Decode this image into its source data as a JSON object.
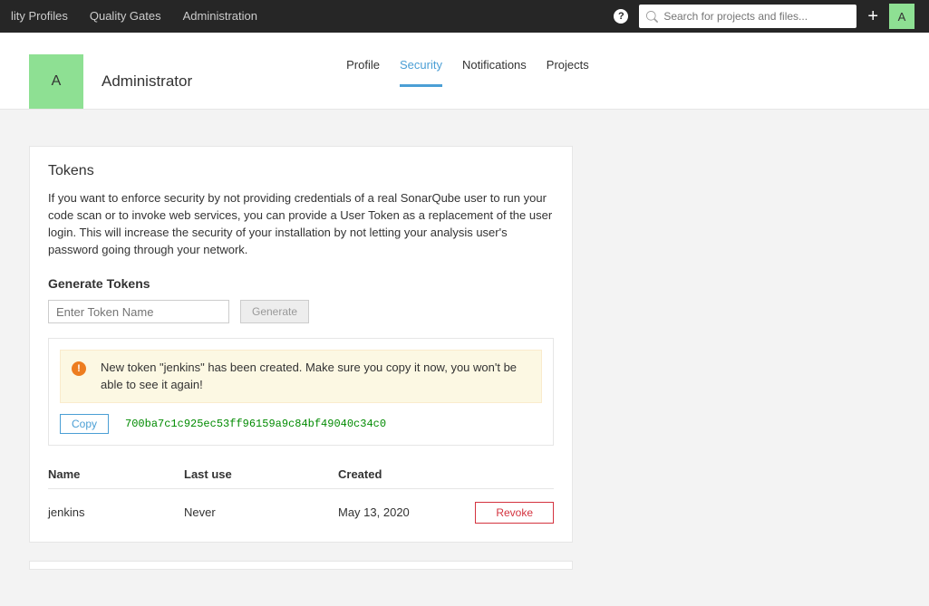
{
  "topnav": {
    "items": [
      "lity Profiles",
      "Quality Gates",
      "Administration"
    ],
    "search_placeholder": "Search for projects and files...",
    "avatar_letter": "A"
  },
  "user": {
    "avatar_letter": "A",
    "name": "Administrator"
  },
  "tabs": [
    "Profile",
    "Security",
    "Notifications",
    "Projects"
  ],
  "active_tab_index": 1,
  "tokens_panel": {
    "title": "Tokens",
    "description": "If you want to enforce security by not providing credentials of a real SonarQube user to run your code scan or to invoke web services, you can provide a User Token as a replacement of the user login. This will increase the security of your installation by not letting your analysis user's password going through your network.",
    "generate_label": "Generate Tokens",
    "token_name_placeholder": "Enter Token Name",
    "generate_button": "Generate",
    "alert_message": "New token \"jenkins\" has been created. Make sure you copy it now, you won't be able to see it again!",
    "copy_button": "Copy",
    "token_value": "700ba7c1c925ec53ff96159a9c84bf49040c34c0",
    "columns": {
      "name": "Name",
      "last_use": "Last use",
      "created": "Created"
    },
    "rows": [
      {
        "name": "jenkins",
        "last_use": "Never",
        "created": "May 13, 2020"
      }
    ],
    "revoke_button": "Revoke"
  }
}
